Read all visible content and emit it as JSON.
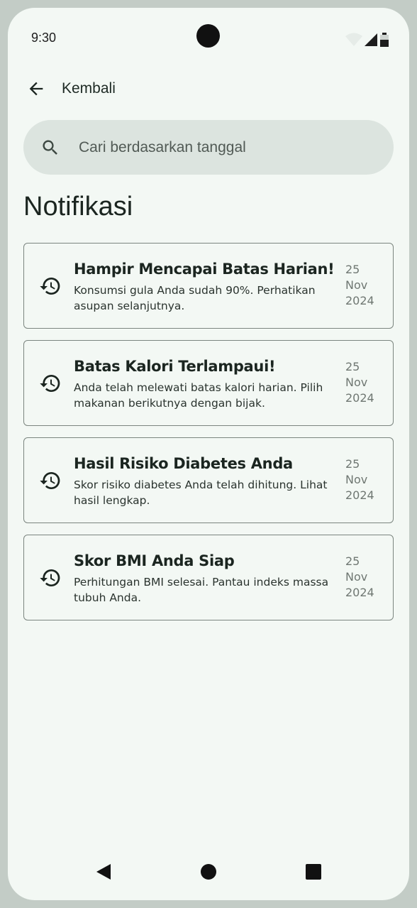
{
  "status_bar": {
    "time": "9:30",
    "icons": [
      "wifi-icon",
      "signal-icon",
      "battery-icon"
    ]
  },
  "header": {
    "back_label": "Kembali",
    "back_icon": "arrow-left-icon"
  },
  "search": {
    "placeholder": "Cari berdasarkan tanggal",
    "icon": "search-icon"
  },
  "page_title": "Notifikasi",
  "notifications": [
    {
      "title": "Hampir Mencapai Batas Harian!",
      "body": "Konsumsi gula Anda sudah 90%. Perhatikan asupan selanjutnya.",
      "date_day": "25",
      "date_month": "Nov",
      "date_year": "2024",
      "icon": "history-icon"
    },
    {
      "title": "Batas Kalori Terlampaui!",
      "body": "Anda telah melewati batas kalori harian. Pilih makanan berikutnya dengan bijak.",
      "date_day": "25",
      "date_month": "Nov",
      "date_year": "2024",
      "icon": "history-icon"
    },
    {
      "title": "Hasil Risiko Diabetes Anda",
      "body": "Skor risiko diabetes Anda telah dihitung. Lihat hasil lengkap.",
      "date_day": "25",
      "date_month": "Nov",
      "date_year": "2024",
      "icon": "history-icon"
    },
    {
      "title": "Skor BMI Anda Siap",
      "body": "Perhitungan BMI selesai. Pantau indeks massa tubuh Anda.",
      "date_day": "25",
      "date_month": "Nov",
      "date_year": "2024",
      "icon": "history-icon"
    }
  ],
  "nav_bar": {
    "icons": [
      "back-triangle-icon",
      "home-circle-icon",
      "recents-square-icon"
    ]
  },
  "colors": {
    "background": "#f3f8f4",
    "frame": "#c3ccc6",
    "search_bg": "#dce4df",
    "card_border": "#7b857f",
    "text_primary": "#1b2520",
    "text_muted": "#6f7772"
  }
}
